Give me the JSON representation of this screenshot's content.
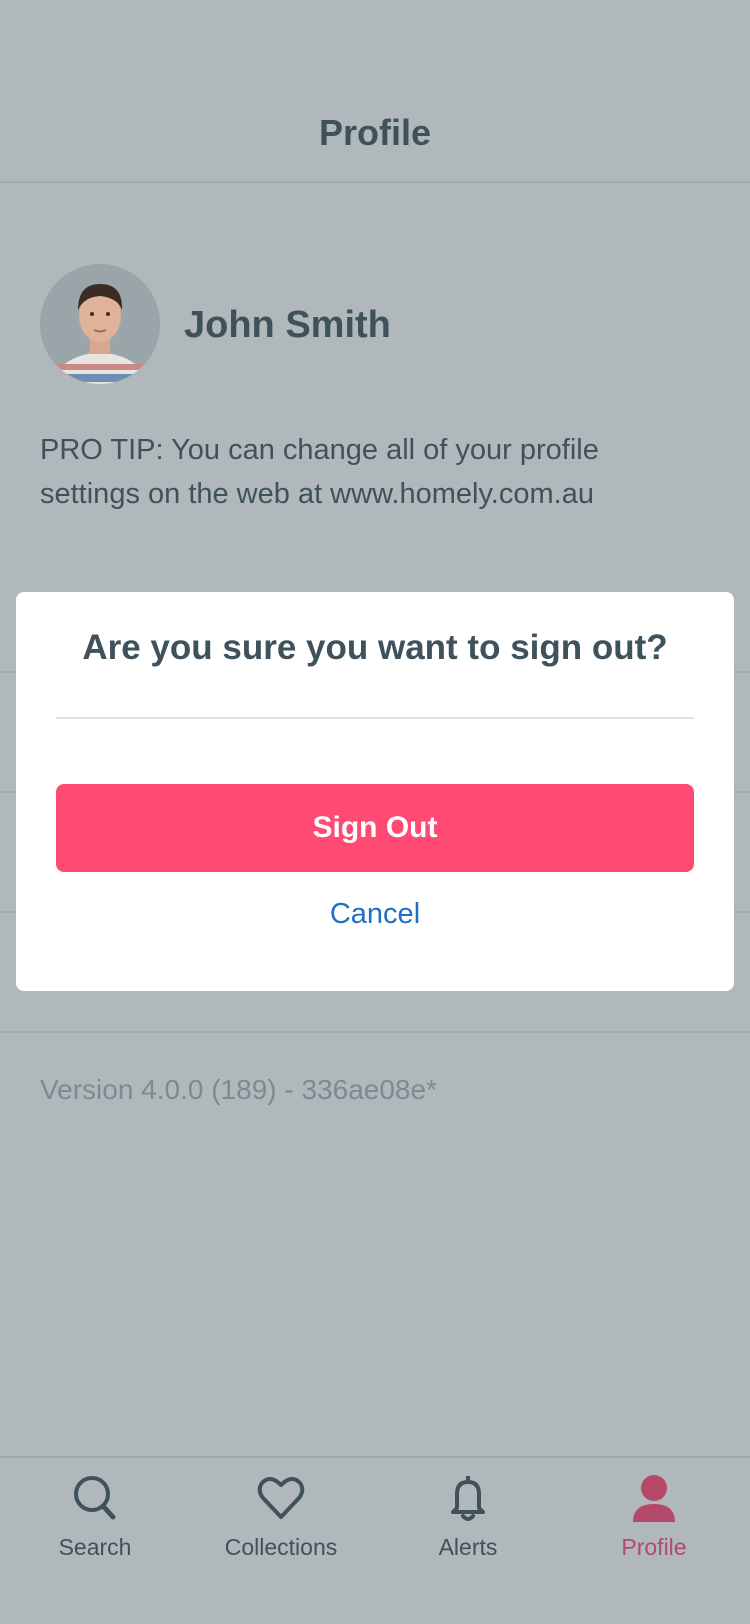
{
  "header": {
    "title": "Profile"
  },
  "profile": {
    "name": "John Smith"
  },
  "protip": "PRO TIP: You can change all of your profile settings on the web at www.homely.com.au",
  "version": "Version 4.0.0 (189) - 336ae08e*",
  "dialog": {
    "title": "Are you sure you want to sign out?",
    "primary_label": "Sign Out",
    "cancel_label": "Cancel"
  },
  "tabs": [
    {
      "label": "Search",
      "icon": "search-icon"
    },
    {
      "label": "Collections",
      "icon": "heart-icon"
    },
    {
      "label": "Alerts",
      "icon": "bell-icon"
    },
    {
      "label": "Profile",
      "icon": "person-icon",
      "active": true
    }
  ],
  "colors": {
    "accent": "#ff4a74",
    "link": "#1f6fc5",
    "active_tab": "#b4496a",
    "overlay_bg": "#b1b8bc"
  }
}
